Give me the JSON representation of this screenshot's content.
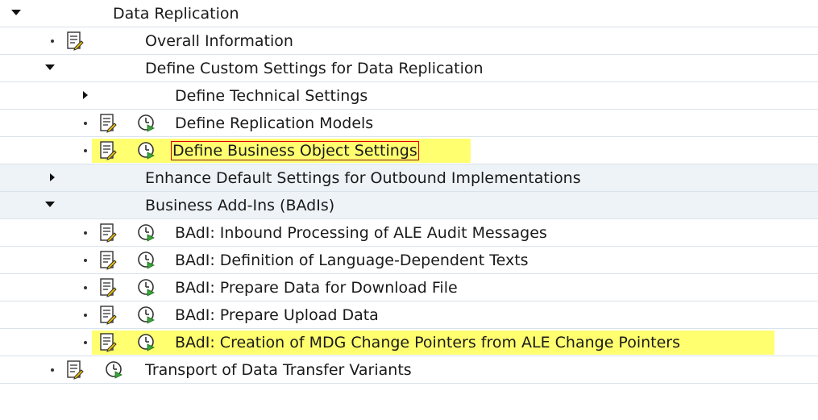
{
  "tree": {
    "root_label": "Data Replication",
    "overall_info": "Overall Information",
    "custom_settings": "Define Custom Settings for Data Replication",
    "technical_settings": "Define Technical Settings",
    "replication_models": "Define Replication Models",
    "business_object_settings": "Define Business Object Settings",
    "enhance_defaults": "Enhance Default Settings for Outbound Implementations",
    "badis": "Business Add-Ins (BAdIs)",
    "badi_items": [
      "BAdI: Inbound Processing of ALE Audit Messages",
      "BAdI: Definition of Language-Dependent Texts",
      "BAdI: Prepare Data for Download File",
      "BAdI: Prepare Upload Data",
      "BAdI: Creation of MDG Change Pointers from ALE Change Pointers"
    ],
    "transport_variants": "Transport of Data Transfer Variants"
  },
  "colors": {
    "highlight": "#ffff70",
    "focus_border": "#e00000",
    "row_shade": "#eef3f7",
    "clock_green": "#3aa53a"
  }
}
